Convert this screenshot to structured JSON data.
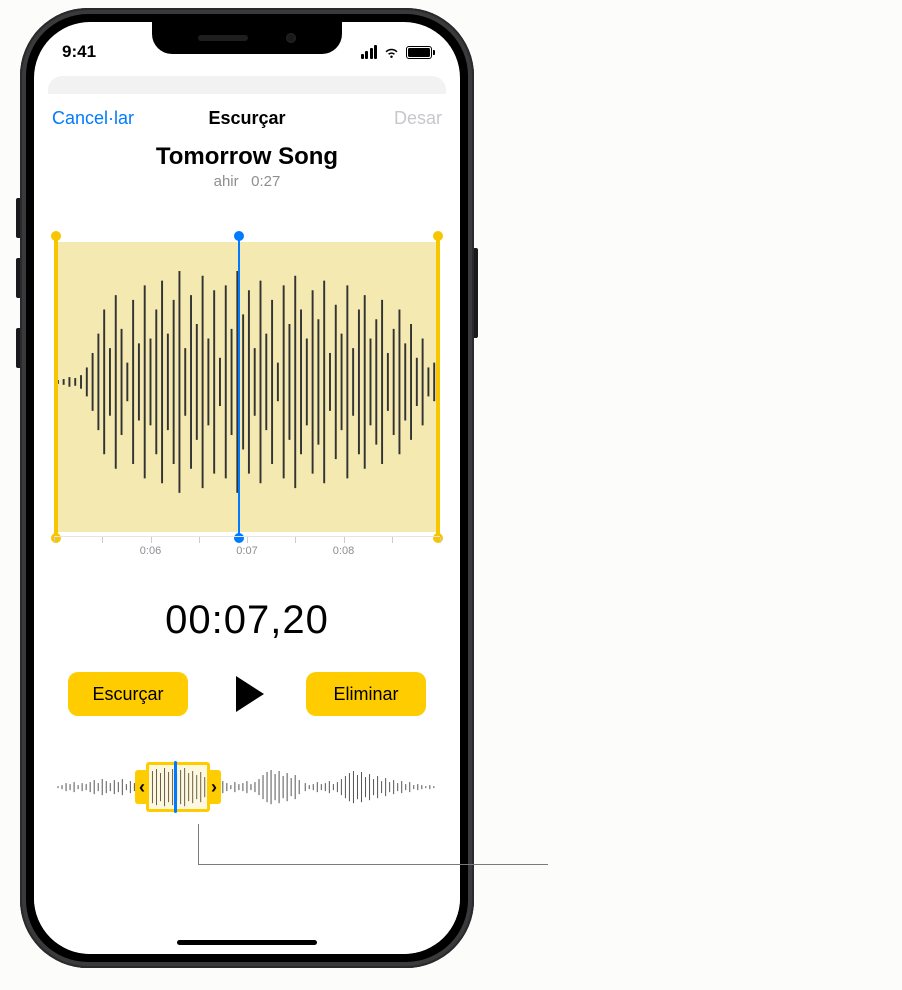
{
  "statusbar": {
    "time": "9:41"
  },
  "nav": {
    "cancel_label": "Cancel·lar",
    "title": "Escurçar",
    "save_label": "Desar"
  },
  "recording": {
    "title": "Tomorrow Song",
    "date": "ahir",
    "duration": "0:27"
  },
  "ruler": {
    "ticks": [
      "0:06",
      "0:07",
      "0:08"
    ]
  },
  "playhead_time": "00:07,20",
  "controls": {
    "trim_label": "Escurçar",
    "delete_label": "Eliminar"
  }
}
